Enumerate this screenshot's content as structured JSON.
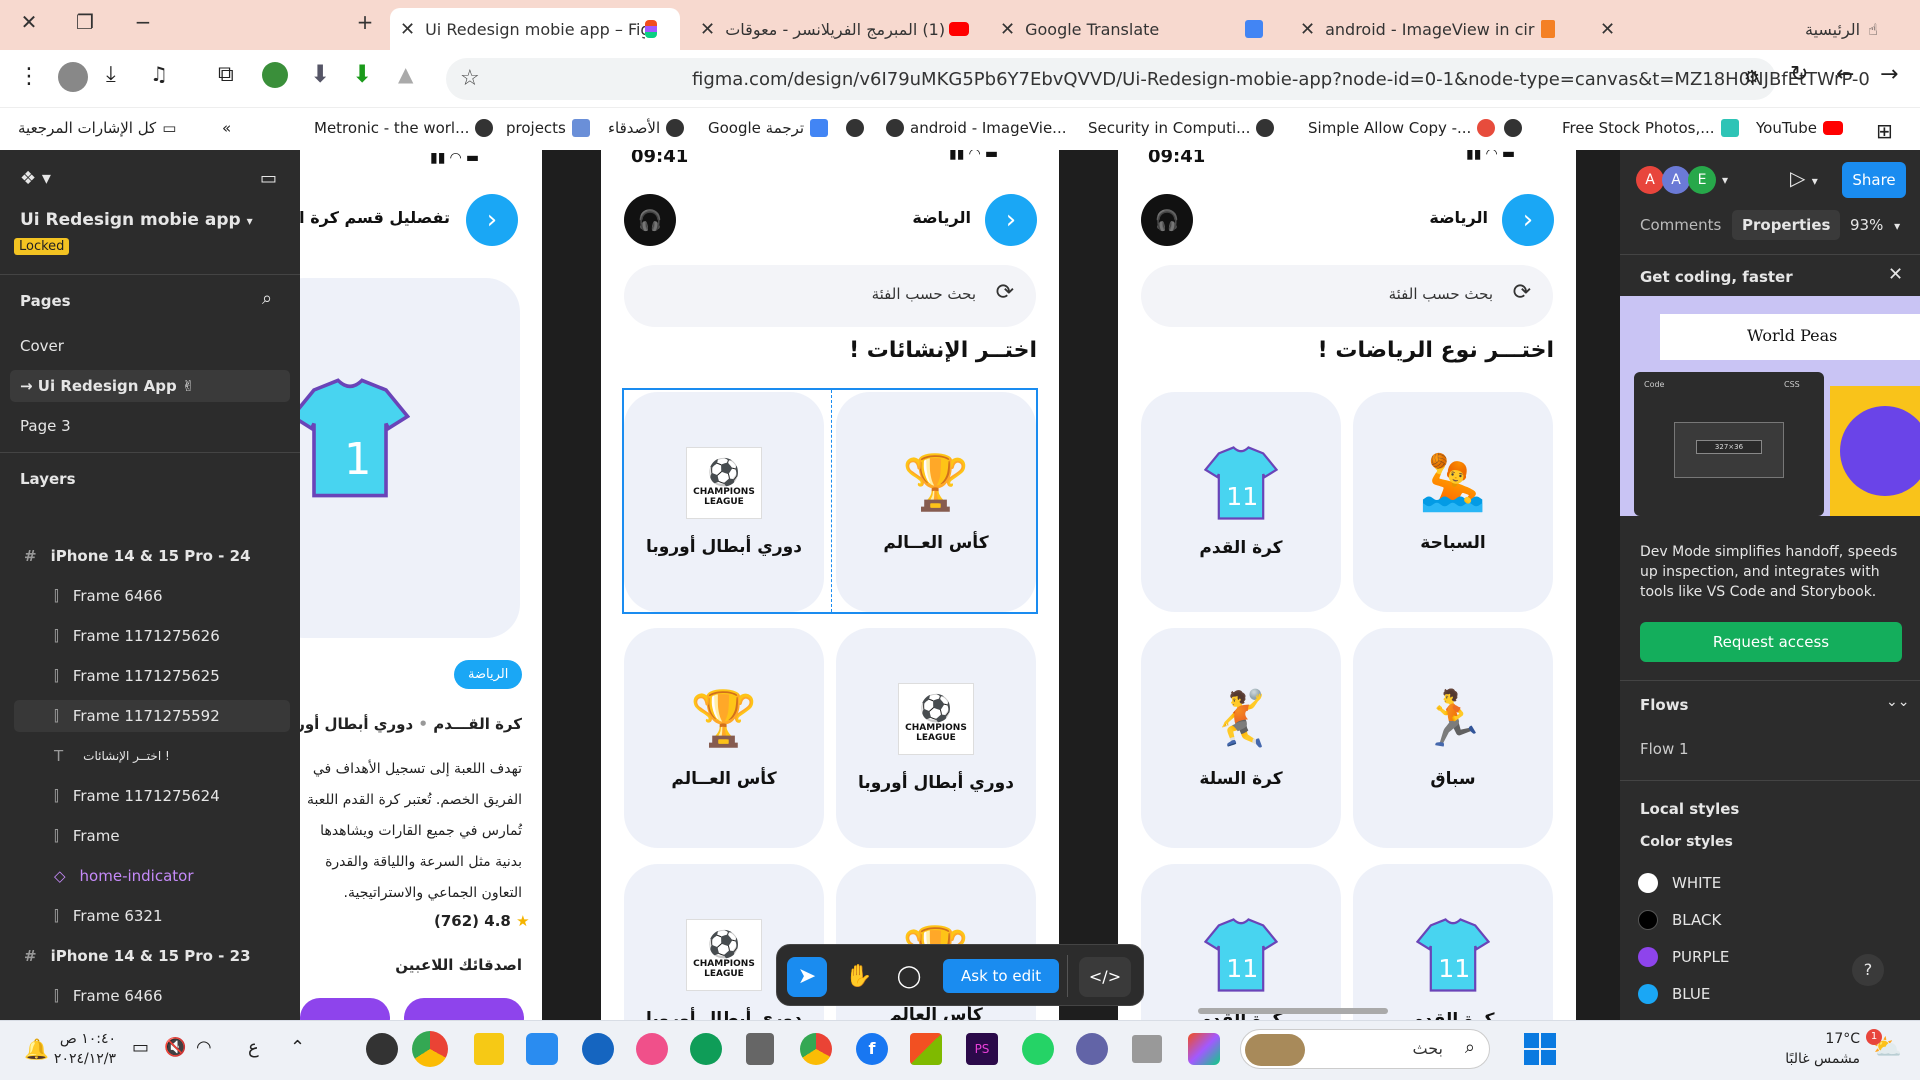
{
  "browser": {
    "tabs": [
      {
        "label": "Ui Redesign mobie app – Figma"
      },
      {
        "label": "(1) المبرمج الفريلانسر - معوقات ا"
      },
      {
        "label": "Google Translate"
      },
      {
        "label": "android - ImageView in circular"
      },
      {
        "label": "الرئيسية"
      }
    ],
    "url": "figma.com/design/v6I79uMKG5Pb6Y7EbvQVVD/Ui-Redesign-mobie-app?node-id=0-1&node-type=canvas&t=MZ18H0NJBfEtTWrP-0",
    "bookmarks": [
      {
        "label": "كل الإشارات المرجعية"
      },
      {
        "label": "Metronic - the worl..."
      },
      {
        "label": "projects"
      },
      {
        "label": "الأصدقاء"
      },
      {
        "label": "Google ترجمة"
      },
      {
        "label": "android - ImageVie..."
      },
      {
        "label": "Security in Computi..."
      },
      {
        "label": "Simple Allow Copy -..."
      },
      {
        "label": "Free Stock Photos,..."
      },
      {
        "label": "YouTube"
      }
    ]
  },
  "left_panel": {
    "file_name": "Ui Redesign mobie app",
    "locked_badge": "Locked",
    "pages_header": "Pages",
    "pages": [
      "Cover",
      "→ Ui Redesign App ✌",
      "Page 3"
    ],
    "layers_header": "Layers",
    "layers": [
      {
        "label": "iPhone 14 & 15 Pro - 24",
        "type": "frame-top"
      },
      {
        "label": "Frame 6466",
        "type": "frame"
      },
      {
        "label": "Frame 1171275626",
        "type": "frame"
      },
      {
        "label": "Frame 1171275625",
        "type": "frame"
      },
      {
        "label": "Frame 1171275592",
        "type": "frame"
      },
      {
        "label": "اختــر الإنشائات !",
        "type": "text"
      },
      {
        "label": "Frame 1171275624",
        "type": "frame"
      },
      {
        "label": "Frame",
        "type": "frame"
      },
      {
        "label": "home-indicator",
        "type": "component"
      },
      {
        "label": "Frame 6321",
        "type": "frame"
      },
      {
        "label": "iPhone 14 & 15 Pro - 23",
        "type": "frame-top"
      },
      {
        "label": "Frame 6466",
        "type": "frame"
      }
    ]
  },
  "screen1": {
    "header_title": "تفصليل قسم كرة القدم",
    "badge": "الرياضة",
    "line_sport": "كرة القـــدم",
    "line_league": "دوري أبطال أوروبا",
    "para": [
      "تهدف اللعبة إلى تسجيل الأهداف في",
      "الفريق الخصم. تُعتبر كرة القدم اللعبة",
      "تُمارس في جميع القارات ويشاهدها",
      "بدنية مثل السرعة واللياقة والقدرة",
      "التعاون الجماعي والاستراتيجية."
    ],
    "rating": "4.8",
    "rating_count": "(762)",
    "friends": "اصدقائك اللاعبين"
  },
  "screen2": {
    "time": "09:41",
    "header_title": "الرياضة",
    "search_placeholder": "بحث حسب الفئة",
    "title": "اختــر الإنشائات !",
    "cards": [
      {
        "label": "كأس العــالم",
        "kind": "cup"
      },
      {
        "label": "دوري أبطال أوروبا",
        "kind": "ucl"
      },
      {
        "label": "دوري أبطال أوروبا",
        "kind": "ucl"
      },
      {
        "label": "كأس العــالم",
        "kind": "cup"
      },
      {
        "label": "كأس العالم",
        "kind": "cup"
      },
      {
        "label": "دوري أبطال أوروبا",
        "kind": "ucl"
      }
    ],
    "ucl_text": [
      "CHAMPIONS",
      "LEAGUE"
    ]
  },
  "screen3": {
    "time": "09:41",
    "header_title": "الرياضة",
    "search_placeholder": "بحث حسب الفئة",
    "title": "اختـــر نوع الرياضات !",
    "cards": [
      {
        "label": "السباحة",
        "icon": "🤽"
      },
      {
        "label": "كرة القدم",
        "icon": "jersey"
      },
      {
        "label": "سباق",
        "icon": "🏃"
      },
      {
        "label": "كرة السلة",
        "icon": "🤾"
      },
      {
        "label": "كرة القدم",
        "icon": "jersey"
      },
      {
        "label": "كرة القدم",
        "icon": "jersey"
      }
    ]
  },
  "toolbar": {
    "ask_label": "Ask to edit"
  },
  "right_panel": {
    "avatars": [
      "A",
      "A",
      "E"
    ],
    "share": "Share",
    "tab_comments": "Comments",
    "tab_properties": "Properties",
    "zoom": "93%",
    "promo_title": "Get coding, faster",
    "promo_img_text": "World Peas",
    "promo_code_label": "Code",
    "promo_css": "CSS",
    "promo_dims": "327×36",
    "promo_text": "Dev Mode simplifies handoff, speeds up inspection, and integrates with tools like VS Code and Storybook.",
    "request_access": "Request access",
    "flows_header": "Flows",
    "flow_item": "Flow 1",
    "local_styles": "Local styles",
    "color_styles": "Color styles",
    "colors": [
      {
        "name": "WHITE",
        "hex": "#ffffff"
      },
      {
        "name": "BLACK",
        "hex": "#000000"
      },
      {
        "name": "PURPLE",
        "hex": "#8e44ec"
      },
      {
        "name": "BLUE",
        "hex": "#1aa7f5"
      }
    ],
    "help": "?"
  },
  "taskbar": {
    "time": "١٠:٤٠ ص",
    "date": "٢٠٢٤/١٢/٣",
    "lang": "ع",
    "search_placeholder": "بحث",
    "weather_temp": "17°C",
    "weather_text": "مشمس غالبًا",
    "notif_count": "1"
  }
}
